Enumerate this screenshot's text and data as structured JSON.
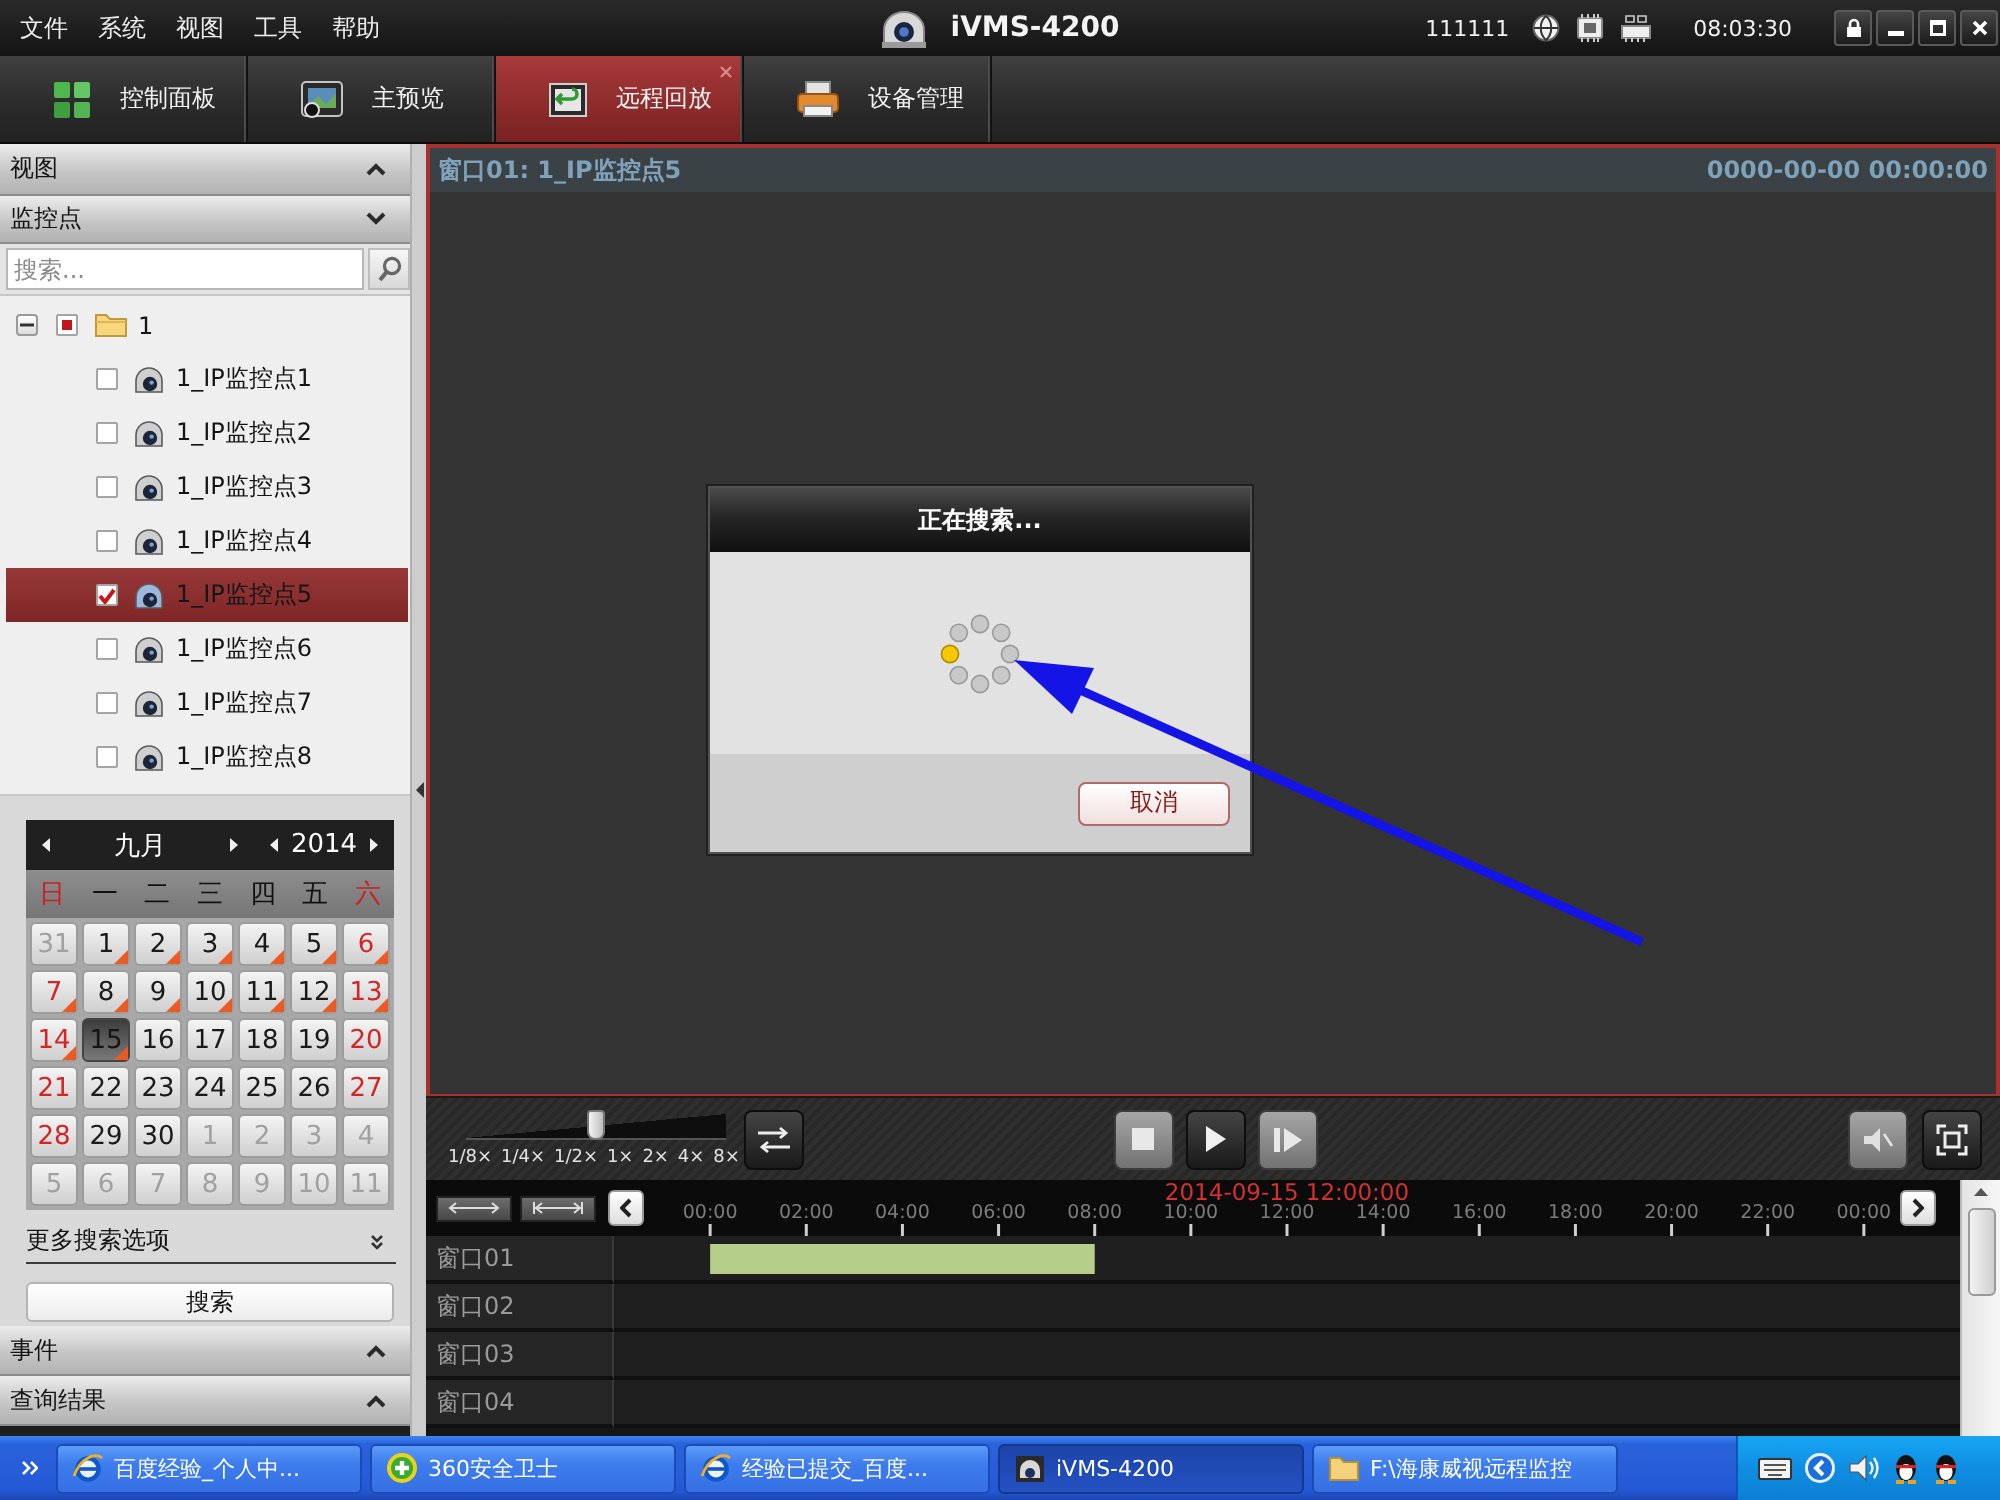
{
  "menu_bar": {
    "menus": [
      "文件",
      "系统",
      "视图",
      "工具",
      "帮助"
    ],
    "title": "iVMS-4200",
    "user": "111111",
    "clock": "08:03:30"
  },
  "tabs": [
    {
      "label": "控制面板",
      "kind": "dashboard",
      "selected": false
    },
    {
      "label": "主预览",
      "kind": "preview",
      "selected": false
    },
    {
      "label": "远程回放",
      "kind": "playback",
      "selected": true
    },
    {
      "label": "设备管理",
      "kind": "device",
      "selected": false
    }
  ],
  "sidebar": {
    "panels": [
      {
        "label": "视图",
        "expanded": false
      },
      {
        "label": "监控点",
        "expanded": true
      }
    ],
    "search": {
      "placeholder": "搜索..."
    },
    "tree": {
      "label": "1",
      "expanded": true,
      "partial": true,
      "children": [
        {
          "label": "1_IP监控点1",
          "checked": false,
          "selected": false
        },
        {
          "label": "1_IP监控点2",
          "checked": false,
          "selected": false
        },
        {
          "label": "1_IP监控点3",
          "checked": false,
          "selected": false
        },
        {
          "label": "1_IP监控点4",
          "checked": false,
          "selected": false
        },
        {
          "label": "1_IP监控点5",
          "checked": true,
          "selected": true
        },
        {
          "label": "1_IP监控点6",
          "checked": false,
          "selected": false
        },
        {
          "label": "1_IP监控点7",
          "checked": false,
          "selected": false
        },
        {
          "label": "1_IP监控点8",
          "checked": false,
          "selected": false
        }
      ]
    },
    "calendar": {
      "month": "九月",
      "year": "2014",
      "weekdays": [
        {
          "label": "日",
          "weekend": true
        },
        {
          "label": "一",
          "weekend": false
        },
        {
          "label": "二",
          "weekend": false
        },
        {
          "label": "三",
          "weekend": false
        },
        {
          "label": "四",
          "weekend": false
        },
        {
          "label": "五",
          "weekend": false
        },
        {
          "label": "六",
          "weekend": true
        }
      ],
      "days": [
        {
          "day": "31",
          "kind": "other",
          "has_record": false,
          "selected": false
        },
        {
          "day": "1",
          "kind": "weekday",
          "has_record": true,
          "selected": false
        },
        {
          "day": "2",
          "kind": "weekday",
          "has_record": true,
          "selected": false
        },
        {
          "day": "3",
          "kind": "weekday",
          "has_record": true,
          "selected": false
        },
        {
          "day": "4",
          "kind": "weekday",
          "has_record": true,
          "selected": false
        },
        {
          "day": "5",
          "kind": "weekday",
          "has_record": true,
          "selected": false
        },
        {
          "day": "6",
          "kind": "weekend",
          "has_record": true,
          "selected": false
        },
        {
          "day": "7",
          "kind": "weekend",
          "has_record": true,
          "selected": false
        },
        {
          "day": "8",
          "kind": "weekday",
          "has_record": true,
          "selected": false
        },
        {
          "day": "9",
          "kind": "weekday",
          "has_record": true,
          "selected": false
        },
        {
          "day": "10",
          "kind": "weekday",
          "has_record": true,
          "selected": false
        },
        {
          "day": "11",
          "kind": "weekday",
          "has_record": true,
          "selected": false
        },
        {
          "day": "12",
          "kind": "weekday",
          "has_record": true,
          "selected": false
        },
        {
          "day": "13",
          "kind": "weekend",
          "has_record": true,
          "selected": false
        },
        {
          "day": "14",
          "kind": "weekend",
          "has_record": true,
          "selected": false
        },
        {
          "day": "15",
          "kind": "weekday",
          "has_record": true,
          "selected": true
        },
        {
          "day": "16",
          "kind": "weekday",
          "has_record": false,
          "selected": false
        },
        {
          "day": "17",
          "kind": "weekday",
          "has_record": false,
          "selected": false
        },
        {
          "day": "18",
          "kind": "weekday",
          "has_record": false,
          "selected": false
        },
        {
          "day": "19",
          "kind": "weekday",
          "has_record": false,
          "selected": false
        },
        {
          "day": "20",
          "kind": "weekend",
          "has_record": false,
          "selected": false
        },
        {
          "day": "21",
          "kind": "weekend",
          "has_record": false,
          "selected": false
        },
        {
          "day": "22",
          "kind": "weekday",
          "has_record": false,
          "selected": false
        },
        {
          "day": "23",
          "kind": "weekday",
          "has_record": false,
          "selected": false
        },
        {
          "day": "24",
          "kind": "weekday",
          "has_record": false,
          "selected": false
        },
        {
          "day": "25",
          "kind": "weekday",
          "has_record": false,
          "selected": false
        },
        {
          "day": "26",
          "kind": "weekday",
          "has_record": false,
          "selected": false
        },
        {
          "day": "27",
          "kind": "weekend",
          "has_record": false,
          "selected": false
        },
        {
          "day": "28",
          "kind": "weekend",
          "has_record": false,
          "selected": false
        },
        {
          "day": "29",
          "kind": "weekday",
          "has_record": false,
          "selected": false
        },
        {
          "day": "30",
          "kind": "weekday",
          "has_record": false,
          "selected": false
        },
        {
          "day": "1",
          "kind": "other",
          "has_record": false,
          "selected": false
        },
        {
          "day": "2",
          "kind": "other",
          "has_record": false,
          "selected": false
        },
        {
          "day": "3",
          "kind": "other",
          "has_record": false,
          "selected": false
        },
        {
          "day": "4",
          "kind": "other",
          "has_record": false,
          "selected": false
        },
        {
          "day": "5",
          "kind": "other",
          "has_record": false,
          "selected": false
        },
        {
          "day": "6",
          "kind": "other",
          "has_record": false,
          "selected": false
        },
        {
          "day": "7",
          "kind": "other",
          "has_record": false,
          "selected": false
        },
        {
          "day": "8",
          "kind": "other",
          "has_record": false,
          "selected": false
        },
        {
          "day": "9",
          "kind": "other",
          "has_record": false,
          "selected": false
        },
        {
          "day": "10",
          "kind": "other",
          "has_record": false,
          "selected": false
        },
        {
          "day": "11",
          "kind": "other",
          "has_record": false,
          "selected": false
        }
      ]
    },
    "more_options": "更多搜索选项",
    "search_button": "搜索",
    "bottom_panels": [
      {
        "label": "事件",
        "expanded": false
      },
      {
        "label": "查询结果",
        "expanded": false
      }
    ]
  },
  "player": {
    "window_title": "窗口01: 1_IP监控点5",
    "timestamp": "0000-00-00 00:00:00",
    "dialog": {
      "title": "正在搜索...",
      "cancel_button": "取消"
    },
    "speed": {
      "level": 0.5,
      "labels": [
        "1/8×",
        "1/4×",
        "1/2×",
        "1×",
        "2×",
        "4×",
        "8×"
      ]
    },
    "timeline": {
      "current_time": "2014-09-15 12:00:00",
      "chart_data": {
        "type": "bar",
        "orientation": "horizontal",
        "categories": [
          "窗口01",
          "窗口02",
          "窗口03",
          "窗口04"
        ],
        "base": [
          0,
          null,
          null,
          null
        ],
        "values": [
          8,
          null,
          null,
          null
        ],
        "color": "#b5cf8a",
        "xlim": [
          -2,
          26
        ],
        "xticks": [
          {
            "value": 0,
            "label": "00:00"
          },
          {
            "value": 2,
            "label": "02:00"
          },
          {
            "value": 4,
            "label": "04:00"
          },
          {
            "value": 6,
            "label": "06:00"
          },
          {
            "value": 8,
            "label": "08:00"
          },
          {
            "value": 10,
            "label": "10:00"
          },
          {
            "value": 12,
            "label": "12:00"
          },
          {
            "value": 14,
            "label": "14:00"
          },
          {
            "value": 16,
            "label": "16:00"
          },
          {
            "value": 18,
            "label": "18:00"
          },
          {
            "value": 20,
            "label": "20:00"
          },
          {
            "value": 22,
            "label": "22:00"
          },
          {
            "value": 24,
            "label": "00:00"
          }
        ]
      }
    }
  },
  "taskbar": {
    "tasks": [
      {
        "label": "百度经验_个人中...",
        "kind": "browser",
        "selected": false
      },
      {
        "label": "360安全卫士",
        "kind": "security",
        "selected": false
      },
      {
        "label": "经验已提交_百度...",
        "kind": "browser",
        "selected": false
      },
      {
        "label": "iVMS-4200",
        "kind": "camera",
        "selected": true
      },
      {
        "label": "F:\\海康威视远程监控",
        "kind": "folder",
        "selected": false
      }
    ]
  }
}
